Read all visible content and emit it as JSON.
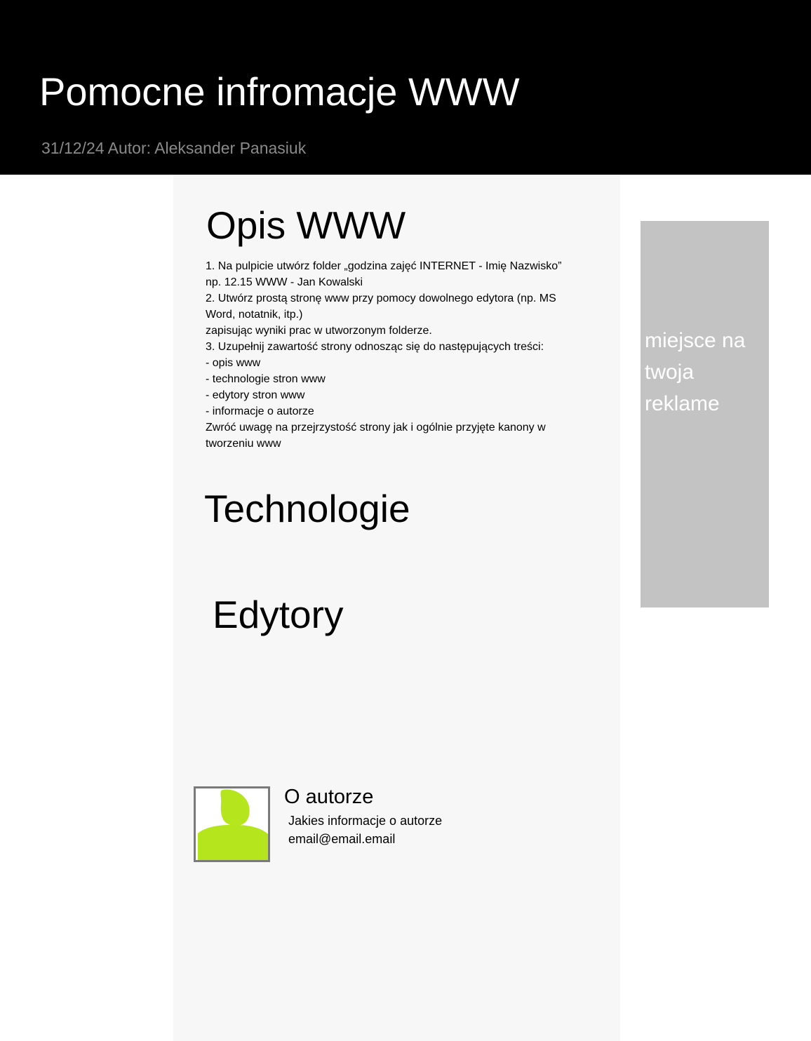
{
  "header": {
    "title": "Pomocne infromacje WWW",
    "meta": "31/12/24 Autor: Aleksander Panasiuk"
  },
  "main": {
    "opis": {
      "title": "Opis WWW",
      "lines": [
        "1. Na pulpicie utwórz folder „godzina zajęć INTERNET - Imię Nazwisko”",
        "np. 12.15 WWW - Jan Kowalski",
        "2. Utwórz prostą stronę www przy pomocy dowolnego edytora (np. MS",
        "Word, notatnik, itp.)",
        "zapisując wyniki prac w utworzonym folderze.",
        "3. Uzupełnij zawartość strony odnosząc się do następujących treści:",
        "- opis www",
        "- technologie stron www",
        "- edytory stron www",
        "- informacje o autorze",
        "Zwróć uwagę na przejrzystość strony jak i ogólnie przyjęte kanony w",
        "tworzeniu www"
      ]
    },
    "technologie": {
      "title": "Technologie"
    },
    "edytory": {
      "title": "Edytory"
    },
    "author": {
      "title": "O autorze",
      "info": "Jakies informacje o autorze",
      "email": "email@email.email",
      "avatar_icon": "user-avatar-icon",
      "avatar_color": "#b5e61d"
    }
  },
  "ad": {
    "lines": [
      "miejsce na",
      "twoja",
      "reklame"
    ]
  },
  "colors": {
    "header_bg": "#000000",
    "main_bg": "#f7f7f7",
    "ad_bg": "#c3c3c3"
  }
}
